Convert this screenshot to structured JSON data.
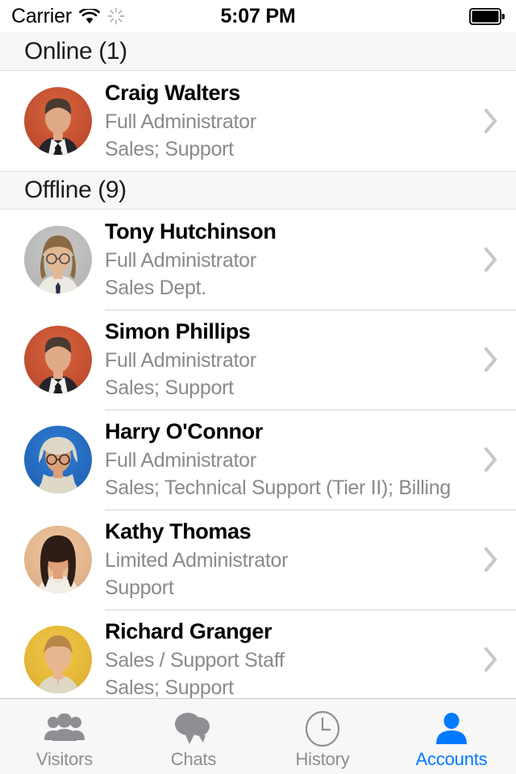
{
  "status_bar": {
    "carrier": "Carrier",
    "wifi_icon": "wifi-icon",
    "activity_icon": "activity-spinner-icon",
    "time": "5:07 PM",
    "battery_icon": "battery-full-icon"
  },
  "sections": [
    {
      "header": "Online (1)",
      "accounts": [
        {
          "name": "Craig Walters",
          "role": "Full Administrator",
          "departments": "Sales; Support",
          "avatar": {
            "bg": "#d9663f",
            "bg2": "#b8452a",
            "skin": "#e0a987",
            "hair": "#4a3a30",
            "clothes": "#23252b",
            "shirt": "#f2f2f0",
            "tie": "#1a1b20",
            "style": "suit-male"
          },
          "disclosure_icon": "chevron-right-icon"
        }
      ]
    },
    {
      "header": "Offline (9)",
      "accounts": [
        {
          "name": "Tony Hutchinson",
          "role": "Full Administrator",
          "departments": "Sales Dept.",
          "avatar": {
            "bg": "#c9c9c7",
            "bg2": "#b2b2b0",
            "skin": "#e3b894",
            "hair": "#8a6a42",
            "clothes": "#eceae2",
            "shirt": "#f5f3ec",
            "tie": "#23304a",
            "style": "glasses-male"
          },
          "disclosure_icon": "chevron-right-icon"
        },
        {
          "name": "Simon Phillips",
          "role": "Full Administrator",
          "departments": "Sales; Support",
          "avatar": {
            "bg": "#d9663f",
            "bg2": "#b8452a",
            "skin": "#e0a987",
            "hair": "#4a3a30",
            "clothes": "#23252b",
            "shirt": "#f2f2f0",
            "tie": "#1a1b20",
            "style": "suit-male"
          },
          "disclosure_icon": "chevron-right-icon"
        },
        {
          "name": "Harry O'Connor",
          "role": "Full Administrator",
          "departments": "Sales; Technical Support (Tier II); Billing",
          "avatar": {
            "bg": "#2f7fd8",
            "bg2": "#1f5fae",
            "skin": "#d9a07a",
            "hair": "#3a2a20",
            "clothes": "#ddd8c8",
            "shirt": "#e6e1d2",
            "tie": "#c9c2ae",
            "style": "hoodie-male"
          },
          "disclosure_icon": "chevron-right-icon"
        },
        {
          "name": "Kathy Thomas",
          "role": "Limited Administrator",
          "departments": "Support",
          "avatar": {
            "bg": "#efc9a4",
            "bg2": "#dcab80",
            "skin": "#dfa078",
            "hair": "#2e1d16",
            "clothes": "#efe8df",
            "shirt": "#f4efe6",
            "tie": "#efe8df",
            "style": "female"
          },
          "disclosure_icon": "chevron-right-icon"
        },
        {
          "name": "Richard Granger",
          "role": "Sales / Support Staff",
          "departments": "Sales; Support",
          "avatar": {
            "bg": "#f2c94c",
            "bg2": "#dcae2c",
            "skin": "#e8b68e",
            "hair": "#b8884a",
            "clothes": "#ded7c4",
            "shirt": "#e8e2d2",
            "tie": "#ded7c4",
            "style": "young-male"
          },
          "disclosure_icon": "chevron-right-icon"
        }
      ]
    }
  ],
  "tab_bar": {
    "active_color": "#007aff",
    "inactive_color": "#8e8e93",
    "tabs": [
      {
        "label": "Visitors",
        "icon": "group-people-icon",
        "active": false
      },
      {
        "label": "Chats",
        "icon": "speech-bubbles-icon",
        "active": false
      },
      {
        "label": "History",
        "icon": "clock-icon",
        "active": false
      },
      {
        "label": "Accounts",
        "icon": "person-icon",
        "active": true
      }
    ]
  }
}
